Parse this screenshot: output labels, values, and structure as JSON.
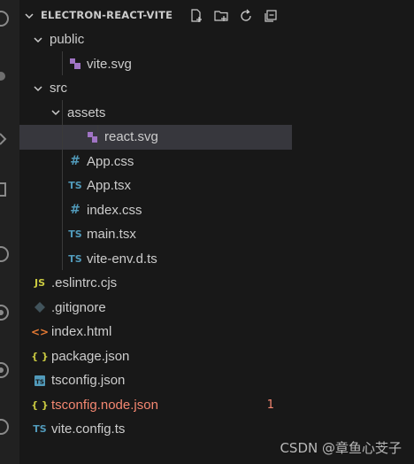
{
  "explorer": {
    "title": "ELECTRON-REACT-VITE",
    "actions": [
      {
        "icon": "new-file-icon"
      },
      {
        "icon": "new-folder-icon"
      },
      {
        "icon": "refresh-icon"
      },
      {
        "icon": "collapse-all-icon"
      }
    ]
  },
  "tree": [
    {
      "label": "public",
      "type": "folder",
      "indent": 0,
      "expanded": true
    },
    {
      "label": "vite.svg",
      "type": "svg",
      "indent": 2
    },
    {
      "label": "src",
      "type": "folder",
      "indent": 0,
      "expanded": true
    },
    {
      "label": "assets",
      "type": "folder",
      "indent": 1,
      "expanded": true
    },
    {
      "label": "react.svg",
      "type": "svg",
      "indent": 3,
      "selected": true
    },
    {
      "label": "App.css",
      "type": "css",
      "indent": 2
    },
    {
      "label": "App.tsx",
      "type": "ts",
      "indent": 2
    },
    {
      "label": "index.css",
      "type": "css",
      "indent": 2
    },
    {
      "label": "main.tsx",
      "type": "ts",
      "indent": 2
    },
    {
      "label": "vite-env.d.ts",
      "type": "ts",
      "indent": 2
    },
    {
      "label": ".eslintrc.cjs",
      "type": "js",
      "indent": 0
    },
    {
      "label": ".gitignore",
      "type": "git",
      "indent": 0
    },
    {
      "label": "index.html",
      "type": "html",
      "indent": 0
    },
    {
      "label": "package.json",
      "type": "json",
      "indent": 0
    },
    {
      "label": "tsconfig.json",
      "type": "tsconfig",
      "indent": 0
    },
    {
      "label": "tsconfig.node.json",
      "type": "json",
      "indent": 0,
      "error": true,
      "badge": "1"
    },
    {
      "label": "vite.config.ts",
      "type": "ts",
      "indent": 0
    }
  ],
  "icon_glyphs": {
    "css": "#",
    "ts": "TS",
    "js": "JS",
    "json": "{ }",
    "html": "<>"
  },
  "colors": {
    "css": "#519aba",
    "ts": "#519aba",
    "js": "#cbcb41",
    "json": "#cbcb41",
    "html": "#e37933",
    "svg": "#a074c4",
    "git": "#41535b",
    "error": "#f48771",
    "selected_bg": "#37373d"
  },
  "watermark": "CSDN @章鱼心芠子"
}
